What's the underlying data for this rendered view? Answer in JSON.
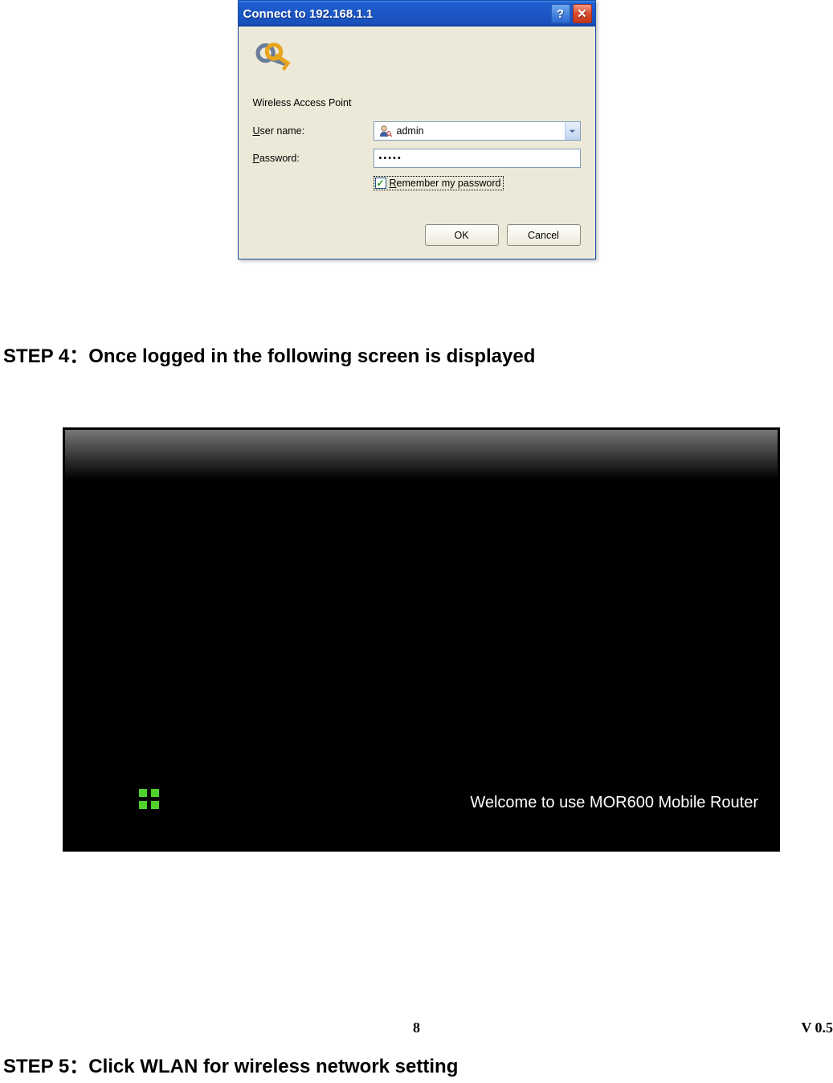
{
  "dialog": {
    "title": "Connect to 192.168.1.1",
    "realm": "Wireless Access Point",
    "username_label_pre": "U",
    "username_label_post": "ser name:",
    "username_value": "admin",
    "password_label_pre": "P",
    "password_label_post": "assword:",
    "password_mask": "•••••",
    "remember_pre": "R",
    "remember_post": "emember my password",
    "ok_label": "OK",
    "cancel_label": "Cancel"
  },
  "steps": {
    "step4": "STEP 4：Once logged in the following screen is displayed",
    "step5": "STEP 5：Click WLAN for wireless network setting"
  },
  "welcome": {
    "text": "Welcome to use MOR600 Mobile Router"
  },
  "footer": {
    "page": "8",
    "version": "V 0.5"
  }
}
